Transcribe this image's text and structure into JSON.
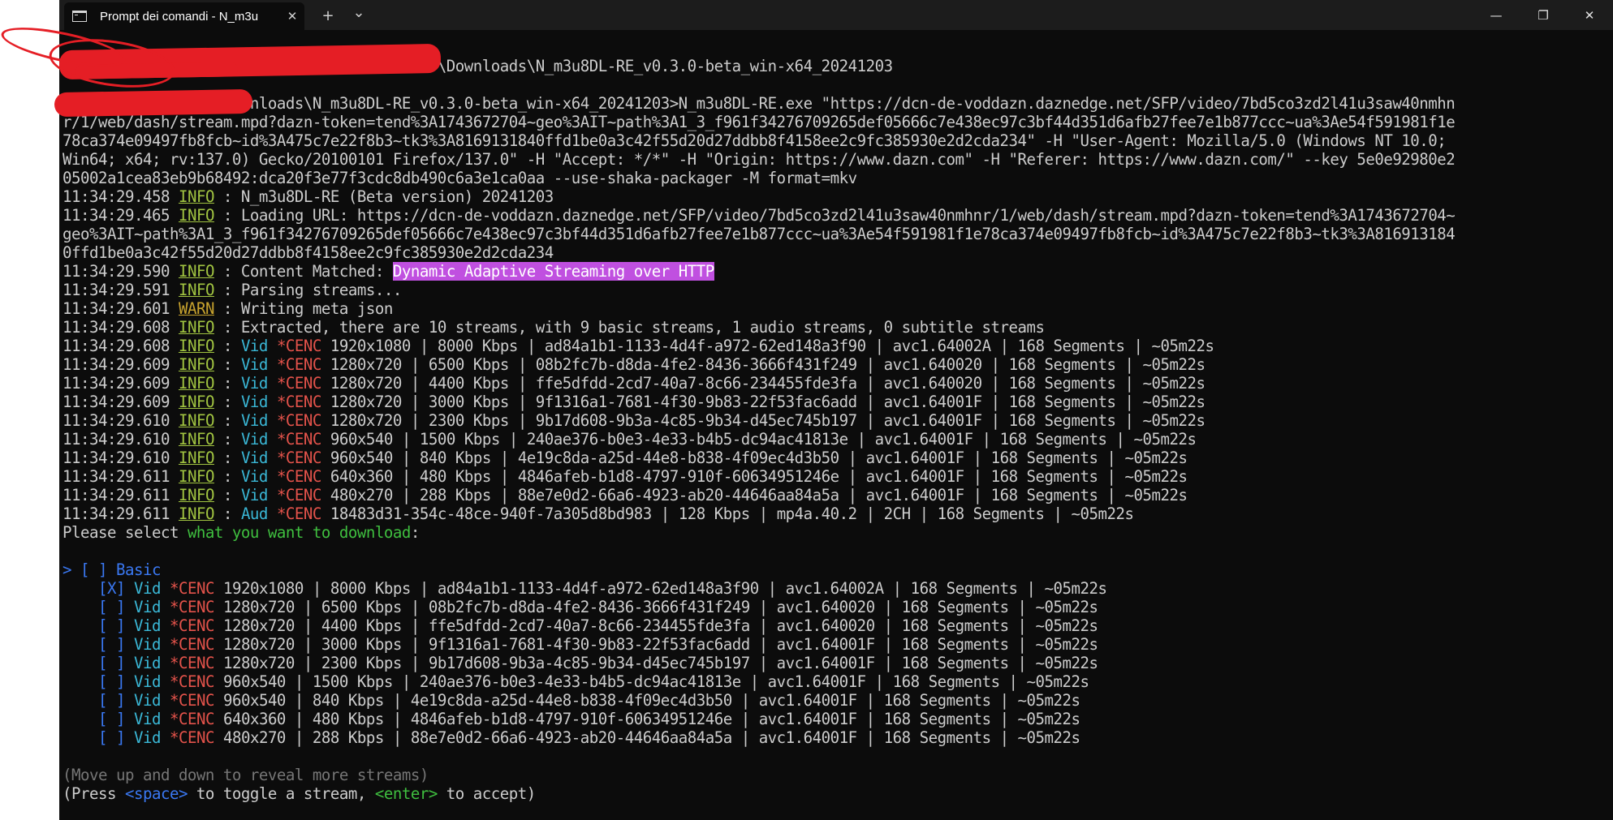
{
  "window": {
    "tab_title": "Prompt dei comandi - N_m3u",
    "new_tab": "+",
    "dropdown": "⌄",
    "tab_close": "✕",
    "minimize": "—",
    "maximize": "❐",
    "close": "✕"
  },
  "terminal": {
    "line0": "                                          \\Downloads\\N_m3u8DL-RE_v0.3.0-beta_win-x64_20241203",
    "cmd": [
      "                   ownloads\\N_m3u8DL-RE_v0.3.0-beta_win-x64_20241203>N_m3u8DL-RE.exe \"https://dcn-de-voddazn.daznedge.net/SFP/video/7bd5co3zd2l41u3saw40nmhn",
      "r/1/web/dash/stream.mpd?dazn-token=tend%3A1743672704~geo%3AIT~path%3A1_3_f961f34276709265def05666c7e438ec97c3bf44d351d6afb27fee7e1b877ccc~ua%3Ae54f591981f1e",
      "78ca374e09497fb8fcb~id%3A475c7e22f8b3~tk3%3A8169131840ffd1be0a3c42f55d20d27ddbb8f4158ee2c9fc385930e2d2cda234\" -H \"User-Agent: Mozilla/5.0 (Windows NT 10.0;",
      "Win64; x64; rv:137.0) Gecko/20100101 Firefox/137.0\" -H \"Accept: */*\" -H \"Origin: https://www.dazn.com\" -H \"Referer: https://www.dazn.com/\" --key 5e0e92980e2",
      "05002a1cea83eb9b68492:dca20f3e77f3cdc8db490c6a3e1ca0aa --use-shaka-packager -M format=mkv"
    ],
    "log": [
      {
        "time": "11:34:29.458",
        "level": "INFO",
        "text": " : N_m3u8DL-RE (Beta version) 20241203"
      },
      {
        "time": "11:34:29.465",
        "level": "INFO",
        "text": " : Loading URL: https://dcn-de-voddazn.daznedge.net/SFP/video/7bd5co3zd2l41u3saw40nmhnr/1/web/dash/stream.mpd?dazn-token=tend%3A1743672704~"
      }
    ],
    "wrap": [
      "geo%3AIT~path%3A1_3_f961f34276709265def05666c7e438ec97c3bf44d351d6afb27fee7e1b877ccc~ua%3Ae54f591981f1e78ca374e09497fb8fcb~id%3A475c7e22f8b3~tk3%3A816913184",
      "0ffd1be0a3c42f55d20d27ddbb8f4158ee2c9fc385930e2d2cda234"
    ],
    "matched": {
      "time": "11:34:29.590",
      "level": "INFO",
      "text": " : Content Matched: ",
      "highlight": "Dynamic Adaptive Streaming over HTTP"
    },
    "log2": [
      {
        "time": "11:34:29.591",
        "level": "INFO",
        "text": " : Parsing streams..."
      },
      {
        "time": "11:34:29.601",
        "level": "WARN",
        "text": " : Writing meta json"
      },
      {
        "time": "11:34:29.608",
        "level": "INFO",
        "text": " : Extracted, there are 10 streams, with 9 basic streams, 1 audio streams, 0 subtitle streams"
      }
    ],
    "streams": [
      {
        "time": "11:34:29.608",
        "level": "INFO",
        "kind": "Vid",
        "cenc": "*CENC",
        "rest": " 1920x1080 | 8000 Kbps | ad84a1b1-1133-4d4f-a972-62ed148a3f90 | avc1.64002A | 168 Segments | ~05m22s"
      },
      {
        "time": "11:34:29.609",
        "level": "INFO",
        "kind": "Vid",
        "cenc": "*CENC",
        "rest": " 1280x720 | 6500 Kbps | 08b2fc7b-d8da-4fe2-8436-3666f431f249 | avc1.640020 | 168 Segments | ~05m22s"
      },
      {
        "time": "11:34:29.609",
        "level": "INFO",
        "kind": "Vid",
        "cenc": "*CENC",
        "rest": " 1280x720 | 4400 Kbps | ffe5dfdd-2cd7-40a7-8c66-234455fde3fa | avc1.640020 | 168 Segments | ~05m22s"
      },
      {
        "time": "11:34:29.609",
        "level": "INFO",
        "kind": "Vid",
        "cenc": "*CENC",
        "rest": " 1280x720 | 3000 Kbps | 9f1316a1-7681-4f30-9b83-22f53fac6add | avc1.64001F | 168 Segments | ~05m22s"
      },
      {
        "time": "11:34:29.610",
        "level": "INFO",
        "kind": "Vid",
        "cenc": "*CENC",
        "rest": " 1280x720 | 2300 Kbps | 9b17d608-9b3a-4c85-9b34-d45ec745b197 | avc1.64001F | 168 Segments | ~05m22s"
      },
      {
        "time": "11:34:29.610",
        "level": "INFO",
        "kind": "Vid",
        "cenc": "*CENC",
        "rest": " 960x540 | 1500 Kbps | 240ae376-b0e3-4e33-b4b5-dc94ac41813e | avc1.64001F | 168 Segments | ~05m22s"
      },
      {
        "time": "11:34:29.610",
        "level": "INFO",
        "kind": "Vid",
        "cenc": "*CENC",
        "rest": " 960x540 | 840 Kbps | 4e19c8da-a25d-44e8-b838-4f09ec4d3b50 | avc1.64001F | 168 Segments | ~05m22s"
      },
      {
        "time": "11:34:29.611",
        "level": "INFO",
        "kind": "Vid",
        "cenc": "*CENC",
        "rest": " 640x360 | 480 Kbps | 4846afeb-b1d8-4797-910f-60634951246e | avc1.64001F | 168 Segments | ~05m22s"
      },
      {
        "time": "11:34:29.611",
        "level": "INFO",
        "kind": "Vid",
        "cenc": "*CENC",
        "rest": " 480x270 | 288 Kbps | 88e7e0d2-66a6-4923-ab20-44646aa84a5a | avc1.64001F | 168 Segments | ~05m22s"
      },
      {
        "time": "11:34:29.611",
        "level": "INFO",
        "kind": "Aud",
        "cenc": "*CENC",
        "rest": " 18483d31-354c-48ce-940f-7a305d8bd983 | 128 Kbps | mp4a.40.2 | 2CH | 168 Segments | ~05m22s"
      }
    ],
    "prompt": {
      "prefix": "Please select ",
      "highlight": "what you want to download",
      ":": ":"
    },
    "group": {
      "cursor": "> ",
      "box": "[ ]",
      "label": "Basic"
    },
    "selections": [
      {
        "box": "[X]",
        "kind": "Vid",
        "cenc": "*CENC",
        "rest": " 1920x1080 | 8000 Kbps | ad84a1b1-1133-4d4f-a972-62ed148a3f90 | avc1.64002A | 168 Segments | ~05m22s"
      },
      {
        "box": "[ ]",
        "kind": "Vid",
        "cenc": "*CENC",
        "rest": " 1280x720 | 6500 Kbps | 08b2fc7b-d8da-4fe2-8436-3666f431f249 | avc1.640020 | 168 Segments | ~05m22s"
      },
      {
        "box": "[ ]",
        "kind": "Vid",
        "cenc": "*CENC",
        "rest": " 1280x720 | 4400 Kbps | ffe5dfdd-2cd7-40a7-8c66-234455fde3fa | avc1.640020 | 168 Segments | ~05m22s"
      },
      {
        "box": "[ ]",
        "kind": "Vid",
        "cenc": "*CENC",
        "rest": " 1280x720 | 3000 Kbps | 9f1316a1-7681-4f30-9b83-22f53fac6add | avc1.64001F | 168 Segments | ~05m22s"
      },
      {
        "box": "[ ]",
        "kind": "Vid",
        "cenc": "*CENC",
        "rest": " 1280x720 | 2300 Kbps | 9b17d608-9b3a-4c85-9b34-d45ec745b197 | avc1.64001F | 168 Segments | ~05m22s"
      },
      {
        "box": "[ ]",
        "kind": "Vid",
        "cenc": "*CENC",
        "rest": " 960x540 | 1500 Kbps | 240ae376-b0e3-4e33-b4b5-dc94ac41813e | avc1.64001F | 168 Segments | ~05m22s"
      },
      {
        "box": "[ ]",
        "kind": "Vid",
        "cenc": "*CENC",
        "rest": " 960x540 | 840 Kbps | 4e19c8da-a25d-44e8-b838-4f09ec4d3b50 | avc1.64001F | 168 Segments | ~05m22s"
      },
      {
        "box": "[ ]",
        "kind": "Vid",
        "cenc": "*CENC",
        "rest": " 640x360 | 480 Kbps | 4846afeb-b1d8-4797-910f-60634951246e | avc1.64001F | 168 Segments | ~05m22s"
      },
      {
        "box": "[ ]",
        "kind": "Vid",
        "cenc": "*CENC",
        "rest": " 480x270 | 288 Kbps | 88e7e0d2-66a6-4923-ab20-44646aa84a5a | avc1.64001F | 168 Segments | ~05m22s"
      }
    ],
    "hint1": "(Move up and down to reveal more streams)",
    "hint2": {
      "prefix": "(Press ",
      "space": "<space>",
      "mid": " to toggle a stream, ",
      "enter": "<enter>",
      "suffix": " to accept)"
    }
  },
  "colors": {
    "info": "#a1c441",
    "warn": "#c8a32e",
    "vid": "#3ab7d6",
    "cenc": "#e5534b",
    "highlight": "#c050e0",
    "redaction": "#e51e25"
  }
}
